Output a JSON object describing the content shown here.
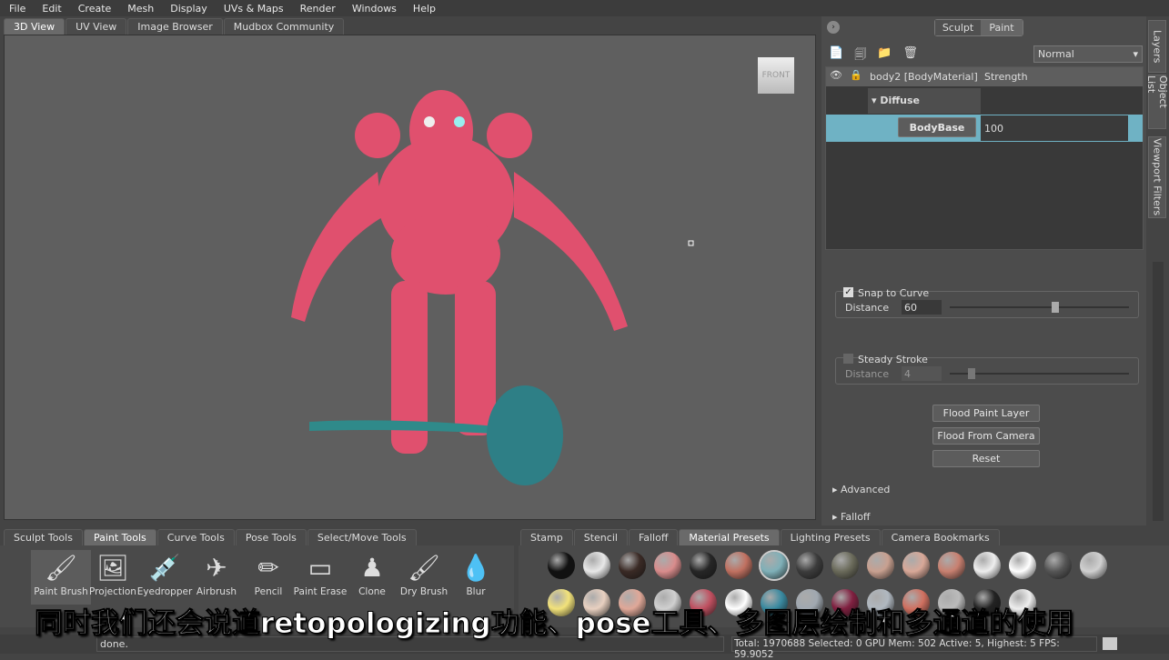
{
  "menu": [
    "File",
    "Edit",
    "Create",
    "Mesh",
    "Display",
    "UVs & Maps",
    "Render",
    "Windows",
    "Help"
  ],
  "view_tabs": [
    "3D View",
    "UV View",
    "Image Browser",
    "Mudbox Community"
  ],
  "viewcube_label": "FRONT",
  "mode_toggle": {
    "sculpt": "Sculpt",
    "paint": "Paint"
  },
  "blend_mode": "Normal",
  "side_tabs": [
    "Layers",
    "Object List",
    "Viewport Filters"
  ],
  "layers": {
    "header_name": "body2 [BodyMaterial]",
    "header_strength": "Strength",
    "group": "Diffuse",
    "layer_name": "BodyBase",
    "layer_strength": "100"
  },
  "props": {
    "snap_label": "Snap to Curve",
    "snap_checked": true,
    "distance_label": "Distance",
    "distance_value": "60",
    "steady_label": "Steady Stroke",
    "steady_checked": false,
    "steady_distance_label": "Distance",
    "steady_distance_value": "4",
    "flood_paint": "Flood Paint Layer",
    "flood_camera": "Flood From Camera",
    "reset": "Reset",
    "advanced": "Advanced",
    "falloff": "Falloff"
  },
  "tool_tabs": [
    "Sculpt Tools",
    "Paint Tools",
    "Curve Tools",
    "Pose Tools",
    "Select/Move Tools"
  ],
  "tools": [
    {
      "label": "Paint Brush",
      "icon": "🖌"
    },
    {
      "label": "Projection",
      "icon": "🖼"
    },
    {
      "label": "Eyedropper",
      "icon": "💉"
    },
    {
      "label": "Airbrush",
      "icon": "✈"
    },
    {
      "label": "Pencil",
      "icon": "✏"
    },
    {
      "label": "Paint Erase",
      "icon": "▭"
    },
    {
      "label": "Clone",
      "icon": "♟"
    },
    {
      "label": "Dry Brush",
      "icon": "🖌"
    },
    {
      "label": "Blur",
      "icon": "💧"
    }
  ],
  "tray_tabs": [
    "Stamp",
    "Stencil",
    "Falloff",
    "Material Presets",
    "Lighting Presets",
    "Camera Bookmarks"
  ],
  "swatches": [
    "#111111",
    "#e8e8e8",
    "#3a2a25",
    "#d98c8c",
    "#262626",
    "#c07060",
    "#7fb0b8",
    "#3c3c3c",
    "#6a6a5a",
    "#c8a090",
    "#d8a898",
    "#c88070",
    "#eeeeee",
    "#ffffff",
    "#555555",
    "#d0d0d0"
  ],
  "swatches2": [
    "#f2e27a",
    "#e8d0c0",
    "#e0a898",
    "#d0d0d0",
    "#c05060",
    "#ffffff",
    "#3a8aa0",
    "#a0a8b0",
    "#802040",
    "#b0b8c0",
    "#d07060",
    "#bbbbbb",
    "#222222",
    "#eeeeee"
  ],
  "status": {
    "message": "done.",
    "stats": "Total: 1970688  Selected: 0 GPU Mem: 502  Active: 5, Highest: 5  FPS: 59.9052"
  },
  "subtitle": "同时我们还会说道retopologizing功能、pose工具、多图层绘制和多通道的使用"
}
